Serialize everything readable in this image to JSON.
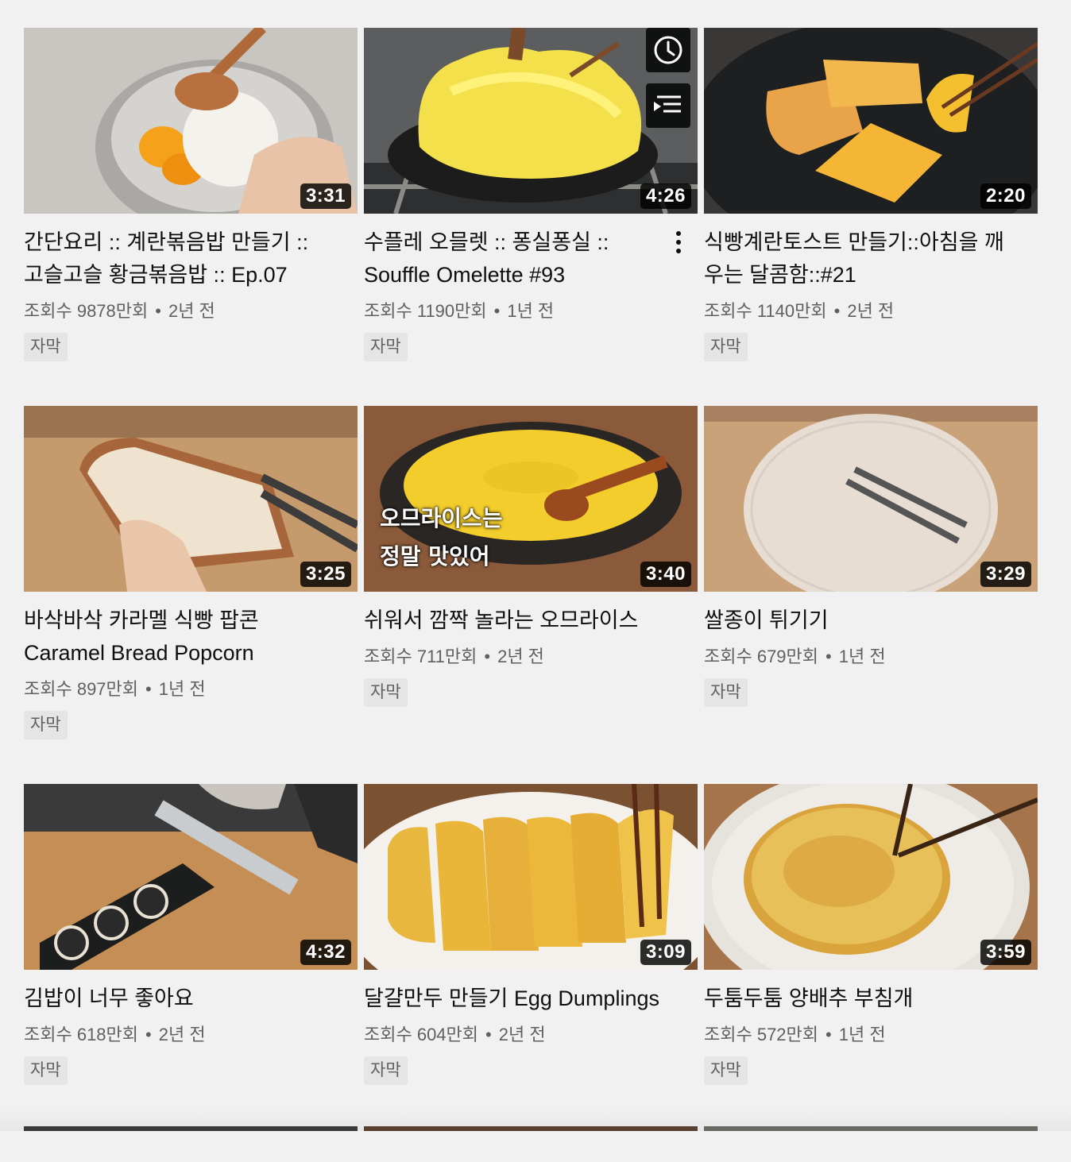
{
  "videos": [
    {
      "title": "간단요리 :: 계란볶음밥 만들기 :: 고슬고슬 황금볶음밥 :: Ep.07",
      "views": "조회수 9878만회",
      "age": "2년 전",
      "duration": "3:31",
      "badge": "자막"
    },
    {
      "title": "수플레 오믈렛 :: 퐁실퐁실 :: Souffle Omelette #93",
      "views": "조회수 1190만회",
      "age": "1년 전",
      "duration": "4:26",
      "badge": "자막"
    },
    {
      "title": "식빵계란토스트 만들기::아침을 깨우는 달콤함::#21",
      "views": "조회수 1140만회",
      "age": "2년 전",
      "duration": "2:20",
      "badge": "자막"
    },
    {
      "title": "바삭바삭 카라멜 식빵 팝콘 Caramel Bread Popcorn",
      "views": "조회수 897만회",
      "age": "1년 전",
      "duration": "3:25",
      "badge": "자막"
    },
    {
      "title": "쉬워서 깜짝 놀라는 오므라이스",
      "views": "조회수 711만회",
      "age": "2년 전",
      "duration": "3:40",
      "badge": "자막",
      "overlay": [
        "오므라이스는",
        "정말 맛있어"
      ]
    },
    {
      "title": "쌀종이 튀기기",
      "views": "조회수 679만회",
      "age": "1년 전",
      "duration": "3:29",
      "badge": "자막"
    },
    {
      "title": "김밥이 너무 좋아요",
      "views": "조회수 618만회",
      "age": "2년 전",
      "duration": "4:32",
      "badge": "자막"
    },
    {
      "title": "달걀만두 만들기 Egg Dumplings",
      "views": "조회수 604만회",
      "age": "2년 전",
      "duration": "3:09",
      "badge": "자막"
    },
    {
      "title": "두툼두툼 양배추 부침개",
      "views": "조회수 572만회",
      "age": "1년 전",
      "duration": "3:59",
      "badge": "자막"
    }
  ],
  "separator": "•",
  "icons": {
    "watch_later": "clock-icon",
    "add_to_queue": "queue-icon",
    "more": "more-vert-icon"
  },
  "colors": {
    "background": "#f1f1f1",
    "title": "#0f0f0f",
    "meta": "#606060",
    "badge_bg": "#e5e5e5"
  }
}
